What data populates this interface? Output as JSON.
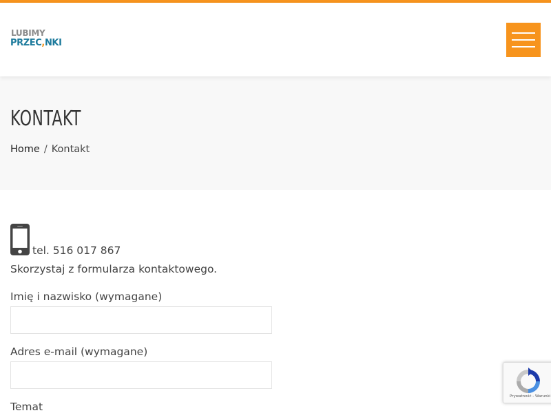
{
  "header": {
    "logo_line1": "LUBIMY",
    "logo_line2_a": "PRZEC",
    "logo_line2_b": "NKI",
    "menu_icon": "hamburger-icon"
  },
  "banner": {
    "title": "KONTAKT",
    "breadcrumb": {
      "home": "Home",
      "separator": "/",
      "current": "Kontakt"
    }
  },
  "contact": {
    "phone_icon": "mobile-phone-icon",
    "phone": "tel. 516 017 867",
    "intro": "Skorzystaj z formularza kontaktowego."
  },
  "form": {
    "name_label": "Imię i nazwisko (wymagane)",
    "name_value": "",
    "email_label": "Adres e-mail (wymagane)",
    "email_value": "",
    "subject_label": "Temat"
  },
  "recaptcha": {
    "icon": "recaptcha-icon",
    "links": "Prywatność - Warunki"
  },
  "colors": {
    "accent": "#f7941d",
    "logo_blue": "#1c7a9c",
    "banner_bg": "#f8f8f8"
  }
}
